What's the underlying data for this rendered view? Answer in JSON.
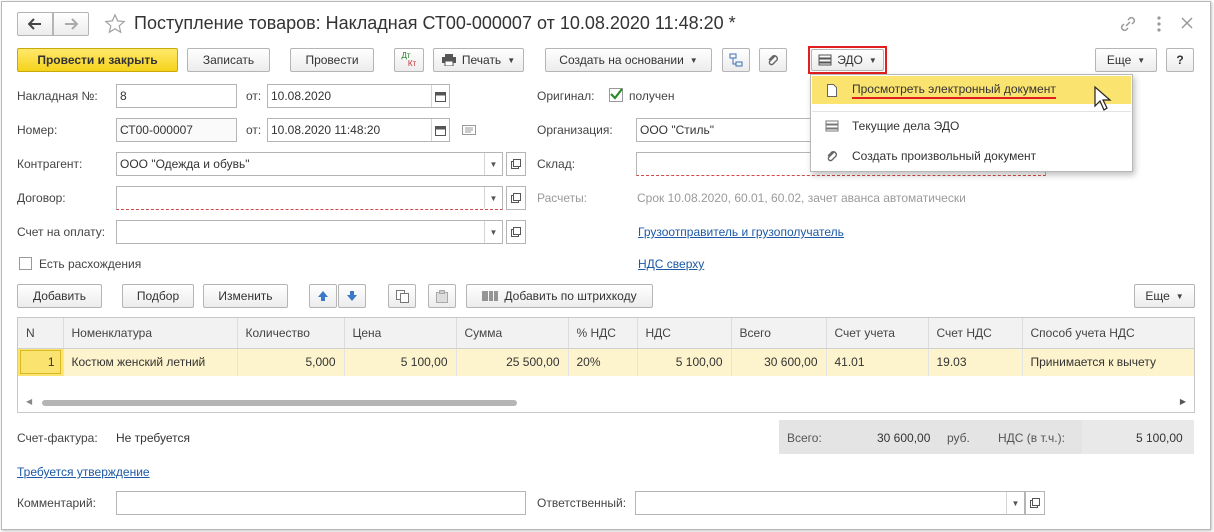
{
  "window": {
    "title": "Поступление товаров: Накладная СТ00-000007 от 10.08.2020 11:48:20 *",
    "star_icon": "star-icon",
    "link_icon": "link-icon",
    "more_icon": "more-vert-icon",
    "close_icon": "close-icon"
  },
  "toolbar": {
    "post_close": "Провести и закрыть",
    "save": "Записать",
    "post": "Провести",
    "dtkt_top": "Дт",
    "dtkt_bottom": "Кт",
    "print": "Печать",
    "create_based": "Создать на основании",
    "edo": "ЭДО",
    "more": "Еще",
    "help": "?"
  },
  "edo_menu": {
    "items": [
      {
        "label": "Просмотреть электронный документ",
        "icon": "document-icon"
      },
      {
        "label": "Текущие дела ЭДО",
        "icon": "list-icon"
      },
      {
        "label": "Создать произвольный документ",
        "icon": "paperclip-icon"
      }
    ]
  },
  "form": {
    "invoice_no_label": "Накладная №:",
    "invoice_no": "8",
    "from_label": "от:",
    "invoice_date": "10.08.2020",
    "number_label": "Номер:",
    "number": "СТ00-000007",
    "number_date": "10.08.2020 11:48:20",
    "counterparty_label": "Контрагент:",
    "counterparty": "ООО \"Одежда и обувь\"",
    "contract_label": "Договор:",
    "contract": "",
    "pay_account_label": "Счет на оплату:",
    "pay_account": "",
    "discrepancy_label": "Есть расхождения",
    "original_label": "Оригинал:",
    "original_value": "получен",
    "org_label": "Организация:",
    "org": "ООО \"Стиль\"",
    "warehouse_label": "Склад:",
    "warehouse": "",
    "settlements_label": "Расчеты:",
    "settlements": "Срок 10.08.2020, 60.01, 60.02, зачет аванса автоматически",
    "shipper_link": "Грузоотправитель и грузополучатель",
    "vat_link": "НДС сверху"
  },
  "table_toolbar": {
    "add": "Добавить",
    "select": "Подбор",
    "change": "Изменить",
    "barcode": "Добавить по штрихкоду",
    "more": "Еще"
  },
  "table": {
    "columns": [
      "N",
      "Номенклатура",
      "Количество",
      "Цена",
      "Сумма",
      "% НДС",
      "НДС",
      "Всего",
      "Счет учета",
      "Счет НДС",
      "Способ учета НДС"
    ],
    "rows": [
      [
        "1",
        "Костюм женский летний",
        "5,000",
        "5 100,00",
        "25 500,00",
        "20%",
        "5 100,00",
        "30 600,00",
        "41.01",
        "19.03",
        "Принимается к вычету"
      ]
    ]
  },
  "footer": {
    "invoice_label": "Счет-фактура:",
    "invoice_value": "Не требуется",
    "approval_link": "Требуется утверждение",
    "comment_label": "Комментарий:",
    "comment": "",
    "responsible_label": "Ответственный:",
    "responsible": "",
    "total_label": "Всего:",
    "total_value": "30 600,00",
    "currency": "руб.",
    "vat_label": "НДС (в т.ч.):",
    "vat_value": "5 100,00"
  }
}
